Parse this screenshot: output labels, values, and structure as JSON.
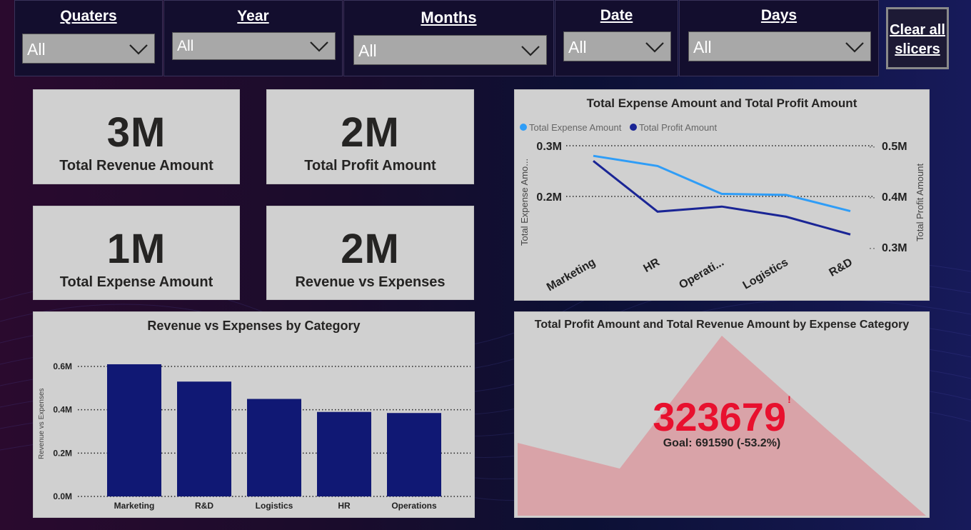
{
  "slicers": [
    {
      "title": "Quaters",
      "value": "All"
    },
    {
      "title": "Year",
      "value": "All"
    },
    {
      "title": "Months",
      "value": "All"
    },
    {
      "title": "Date",
      "value": "All"
    },
    {
      "title": "Days",
      "value": "All"
    }
  ],
  "clear_button": {
    "line1": "Clear all",
    "line2": "slicers"
  },
  "kpis": [
    {
      "value": "3M",
      "label": "Total Revenue Amount"
    },
    {
      "value": "2M",
      "label": "Total Profit Amount"
    },
    {
      "value": "1M",
      "label": "Total Expense Amount"
    },
    {
      "value": "2M",
      "label": "Revenue vs Expenses"
    }
  ],
  "gauge": {
    "title": "Total Profit Amount and Total Revenue Amount by Expense Category",
    "value": "323679",
    "goal": "Goal: 691590 (-53.2%)",
    "alert": "!",
    "fill_color": "#d9a3a8",
    "value_color": "#e8102e"
  },
  "chart_data": [
    {
      "type": "line",
      "title": "Total Expense Amount and Total Profit Amount",
      "categories": [
        "Marketing",
        "HR",
        "Operati...",
        "Logistics",
        "R&D"
      ],
      "series": [
        {
          "name": "Total Expense Amount",
          "axis": "left",
          "color": "#2f9df7",
          "values": [
            0.28,
            0.26,
            0.205,
            0.203,
            0.171
          ]
        },
        {
          "name": "Total Profit Amount",
          "axis": "right",
          "color": "#1a2595",
          "values": [
            0.47,
            0.37,
            0.38,
            0.36,
            0.325
          ]
        }
      ],
      "y_left": {
        "label": "Total Expense Amo...",
        "ticks": [
          "0.3M",
          "0.2M"
        ],
        "range": [
          0.1,
          0.3
        ]
      },
      "y_right": {
        "label": "Total Profit Amount",
        "ticks": [
          "0.5M",
          "0.4M",
          "0.3M"
        ],
        "range": [
          0.3,
          0.5
        ]
      },
      "legend_position": "top-left"
    },
    {
      "type": "bar",
      "title": "Revenue vs Expenses by Category",
      "categories": [
        "Marketing",
        "R&D",
        "Logistics",
        "HR",
        "Operations"
      ],
      "values": [
        0.61,
        0.53,
        0.45,
        0.39,
        0.385
      ],
      "ylabel": "Revenue vs Expenses",
      "ylim": [
        0,
        0.6
      ],
      "yticks": [
        "0.0M",
        "0.2M",
        "0.4M",
        "0.6M"
      ],
      "color": "#101874",
      "grid": true
    }
  ]
}
